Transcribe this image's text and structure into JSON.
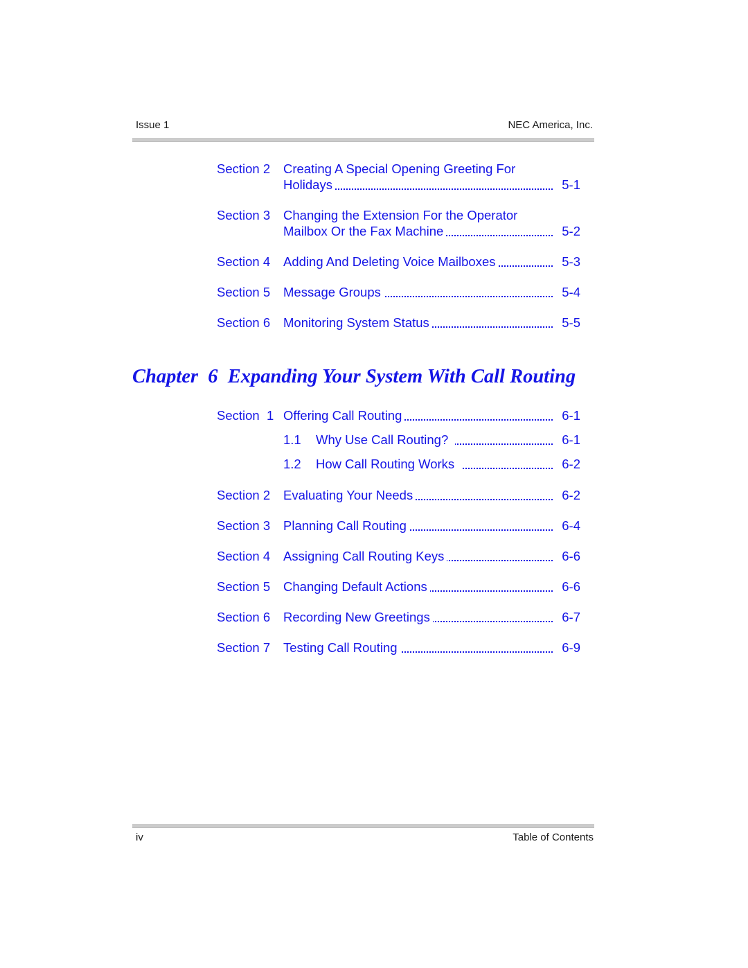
{
  "header": {
    "left": "Issue 1",
    "right": "NEC America, Inc."
  },
  "footer": {
    "left": "iv",
    "right": "Table of Contents"
  },
  "chapter5_entries": [
    {
      "label": "Section 2",
      "title_line1": "Creating A Special Opening Greeting For",
      "title_line2": "Holidays",
      "page": "5-1"
    },
    {
      "label": "Section 3",
      "title_line1": "Changing the Extension For the Operator",
      "title_line2": "Mailbox Or the Fax Machine",
      "page": "5-2"
    },
    {
      "label": "Section 4",
      "title": "Adding And Deleting Voice Mailboxes",
      "page": "5-3"
    },
    {
      "label": "Section 5",
      "title": "Message Groups",
      "page": "5-4"
    },
    {
      "label": "Section 6",
      "title": "Monitoring System Status",
      "page": "5-5"
    }
  ],
  "chapter6": {
    "heading": "Chapter  6  Expanding Your System With Call Routing",
    "entries": [
      {
        "label": "Section  1",
        "title": "Offering Call Routing",
        "page": "6-1"
      },
      {
        "num": "1.1",
        "title": "Why Use Call Routing?",
        "page": "6-1"
      },
      {
        "num": "1.2",
        "title": "How Call Routing Works",
        "page": "6-2"
      },
      {
        "label": "Section 2",
        "title": "Evaluating Your Needs",
        "page": "6-2"
      },
      {
        "label": "Section 3",
        "title": "Planning Call Routing",
        "page": "6-4"
      },
      {
        "label": "Section 4",
        "title": "Assigning Call Routing Keys",
        "page": "6-6"
      },
      {
        "label": "Section 5",
        "title": "Changing Default Actions",
        "page": "6-6"
      },
      {
        "label": "Section 6",
        "title": "Recording New Greetings",
        "page": "6-7"
      },
      {
        "label": "Section 7",
        "title": "Testing Call Routing",
        "page": "6-9"
      }
    ]
  },
  "colors": {
    "link": "#1515e6",
    "rule": "#cccccc",
    "text": "#1a1a1a"
  }
}
